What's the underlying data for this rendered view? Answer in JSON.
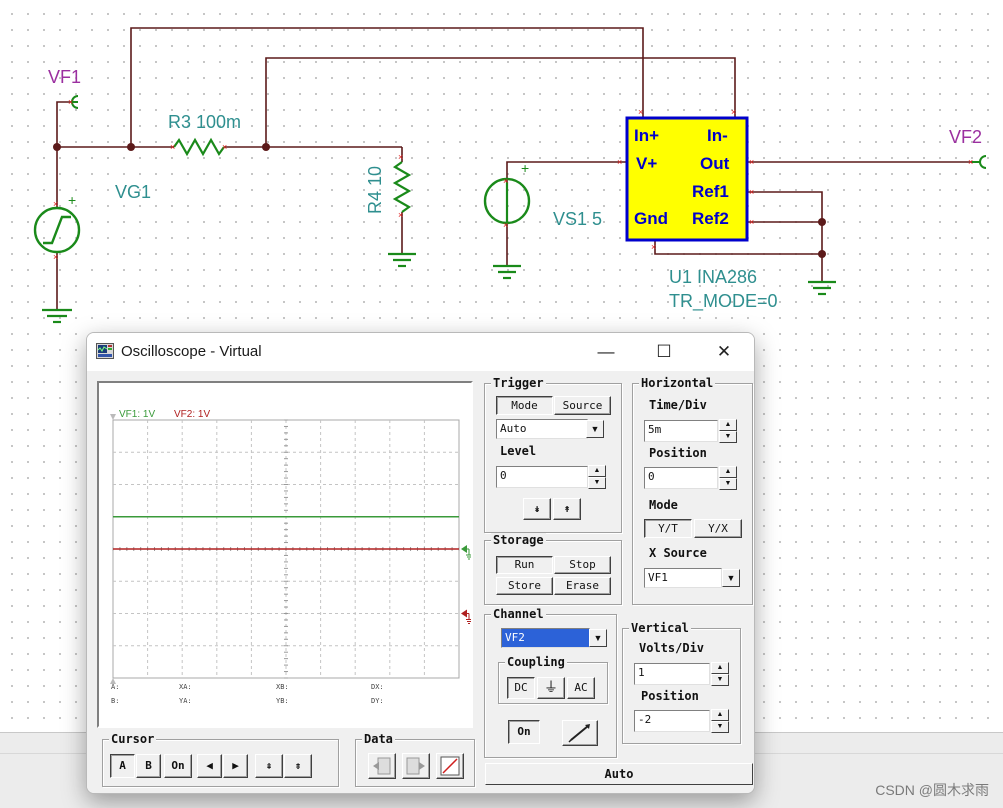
{
  "schematic": {
    "labels": {
      "vf1": "VF1",
      "vf2": "VF2",
      "r3": "R3 100m",
      "r4": "R4 10",
      "vg1": "VG1",
      "vs1": "VS1 5",
      "u1_name": "U1 INA286",
      "u1_mode": "TR_MODE=0",
      "plus_vg": "+",
      "plus_vs": "+"
    },
    "ina286_pins": {
      "in_plus": "In+",
      "in_minus": "In-",
      "v_plus": "V+",
      "out": "Out",
      "ref1": "Ref1",
      "gnd": "Gnd",
      "ref2": "Ref2"
    },
    "colors": {
      "wire": "#5c1a1a",
      "component": "#1a8a1a",
      "label": "#2f8f8f",
      "probe_label": "#9b2fa0",
      "ic_fill": "#ffff00",
      "ic_border": "#0000cc",
      "ic_text": "#0000cc",
      "pin_mark": "#e02020"
    }
  },
  "window": {
    "title": "Oscilloscope - Virtual",
    "icon": "oscilloscope-app-icon",
    "controls": {
      "minimize": "—",
      "maximize": "☐",
      "close": "✕"
    }
  },
  "screen": {
    "ch1_label": "VF1: 1V",
    "ch2_label": "VF2: 1V",
    "trace_colors": {
      "vf1": "#3a9a3a",
      "vf2": "#b02020"
    },
    "trace_levels_div": {
      "vf1": 1.0,
      "vf2": 0.0
    },
    "readouts": {
      "a": "A:",
      "xa": "XA:",
      "xb": "XB:",
      "dx": "DX:",
      "b": "B:",
      "ya": "YA:",
      "yb": "YB:",
      "dy": "DY:"
    }
  },
  "trigger": {
    "title": "Trigger",
    "mode_tab": "Mode",
    "source_tab": "Source",
    "mode_value": "Auto",
    "level_label": "Level",
    "level_value": "0",
    "rising_icon": "rising-edge-icon",
    "falling_icon": "falling-edge-icon"
  },
  "horizontal": {
    "title": "Horizontal",
    "time_div_label": "Time/Div",
    "time_div_value": "5m",
    "position_label": "Position",
    "position_value": "0",
    "mode_label": "Mode",
    "mode_yt": "Y/T",
    "mode_yx": "Y/X",
    "x_source_label": "X Source",
    "x_source_value": "VF1"
  },
  "storage": {
    "title": "Storage",
    "run": "Run",
    "stop": "Stop",
    "store": "Store",
    "erase": "Erase"
  },
  "channel": {
    "title": "Channel",
    "selected": "VF2",
    "coupling_title": "Coupling",
    "dc": "DC",
    "ac": "AC",
    "on": "On",
    "probe_icon": "probe-pen-icon"
  },
  "vertical": {
    "title": "Vertical",
    "volts_div_label": "Volts/Div",
    "volts_div_value": "1",
    "position_label": "Position",
    "position_value": "-2"
  },
  "cursor": {
    "title": "Cursor",
    "a": "A",
    "b": "B",
    "on": "On"
  },
  "data": {
    "title": "Data"
  },
  "auto_button": "Auto",
  "watermark": "CSDN @圆木求雨"
}
